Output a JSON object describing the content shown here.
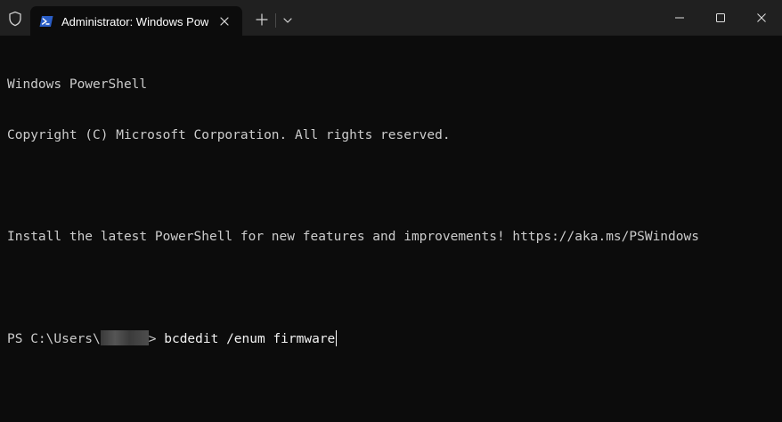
{
  "window": {
    "tab_title": "Administrator: Windows PowerShell",
    "shield_icon": "shield-icon",
    "tab_icon": "powershell-icon",
    "close_tab_icon": "close-icon",
    "new_tab_icon": "plus-icon",
    "dropdown_icon": "chevron-down-icon",
    "minimize_icon": "minimize-icon",
    "maximize_icon": "maximize-icon",
    "close_window_icon": "close-icon"
  },
  "terminal": {
    "lines": [
      "Windows PowerShell",
      "Copyright (C) Microsoft Corporation. All rights reserved.",
      "",
      "Install the latest PowerShell for new features and improvements! https://aka.ms/PSWindows",
      ""
    ],
    "prompt_prefix": "PS C:\\Users\\",
    "prompt_suffix": "> ",
    "command": "bcdedit /enum firmware"
  },
  "colors": {
    "titlebar_bg": "#202020",
    "terminal_bg": "#0c0c0c",
    "terminal_fg": "#cccccc",
    "powershell_blue": "#2a5ec7"
  }
}
